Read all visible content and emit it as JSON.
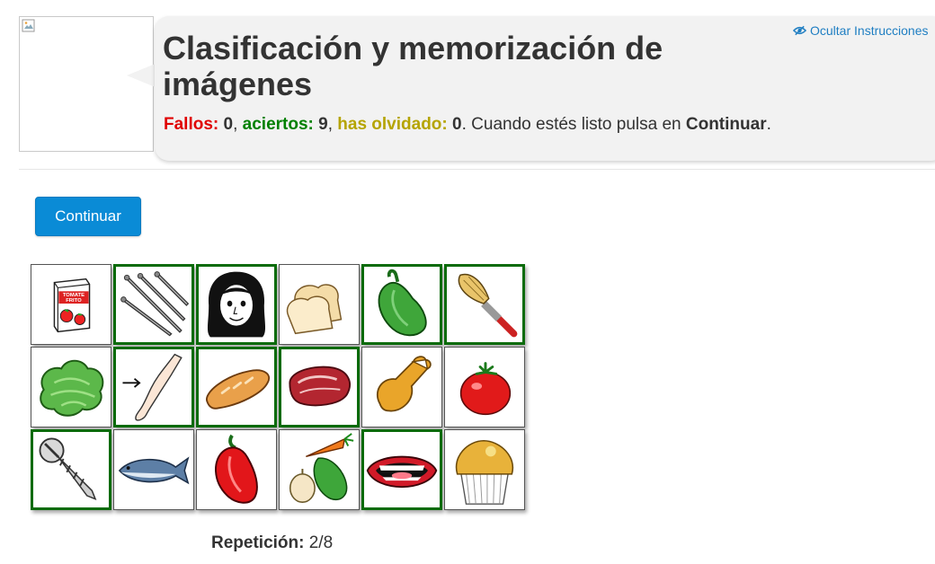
{
  "header": {
    "title": "Clasificación y memorización de imágenes",
    "hide_instructions": "Ocultar Instrucciones"
  },
  "status": {
    "fails_label": "Fallos:",
    "fails_value": "0",
    "hits_label": "aciertos:",
    "hits_value": "9",
    "forgot_label": "has olvidado:",
    "forgot_value": "0",
    "tail_text": ". Cuando estés listo pulsa en ",
    "tail_bold": "Continuar",
    "tail_end": "."
  },
  "colors": {
    "fails": "#e00000",
    "hits": "#008000",
    "forgot": "#b5a400",
    "button": "#0a8bd6",
    "selected_border": "#0a6b0a"
  },
  "continue_button": {
    "label": "Continuar"
  },
  "grid": {
    "rows": 3,
    "cols": 6,
    "cards": [
      {
        "icon": "tomato-sauce-carton-icon",
        "label_text": "TOMATE FRITO",
        "selected": false
      },
      {
        "icon": "nails-icon",
        "selected": true
      },
      {
        "icon": "girl-face-icon",
        "selected": true
      },
      {
        "icon": "bread-slices-icon",
        "selected": false
      },
      {
        "icon": "green-pepper-icon",
        "selected": true
      },
      {
        "icon": "paintbrush-icon",
        "selected": true
      },
      {
        "icon": "lettuce-icon",
        "selected": false
      },
      {
        "icon": "arm-icon",
        "selected": true
      },
      {
        "icon": "baguette-icon",
        "selected": true
      },
      {
        "icon": "meat-steak-icon",
        "selected": true
      },
      {
        "icon": "chicken-leg-icon",
        "selected": false
      },
      {
        "icon": "tomato-icon",
        "selected": false
      },
      {
        "icon": "screw-icon",
        "selected": true
      },
      {
        "icon": "fish-icon",
        "selected": false
      },
      {
        "icon": "red-pepper-icon",
        "selected": false
      },
      {
        "icon": "vegetables-icon",
        "selected": false
      },
      {
        "icon": "mouth-icon",
        "selected": true
      },
      {
        "icon": "muffin-icon",
        "selected": false
      }
    ]
  },
  "repetition": {
    "label": "Repetición:",
    "value": "2/8"
  }
}
